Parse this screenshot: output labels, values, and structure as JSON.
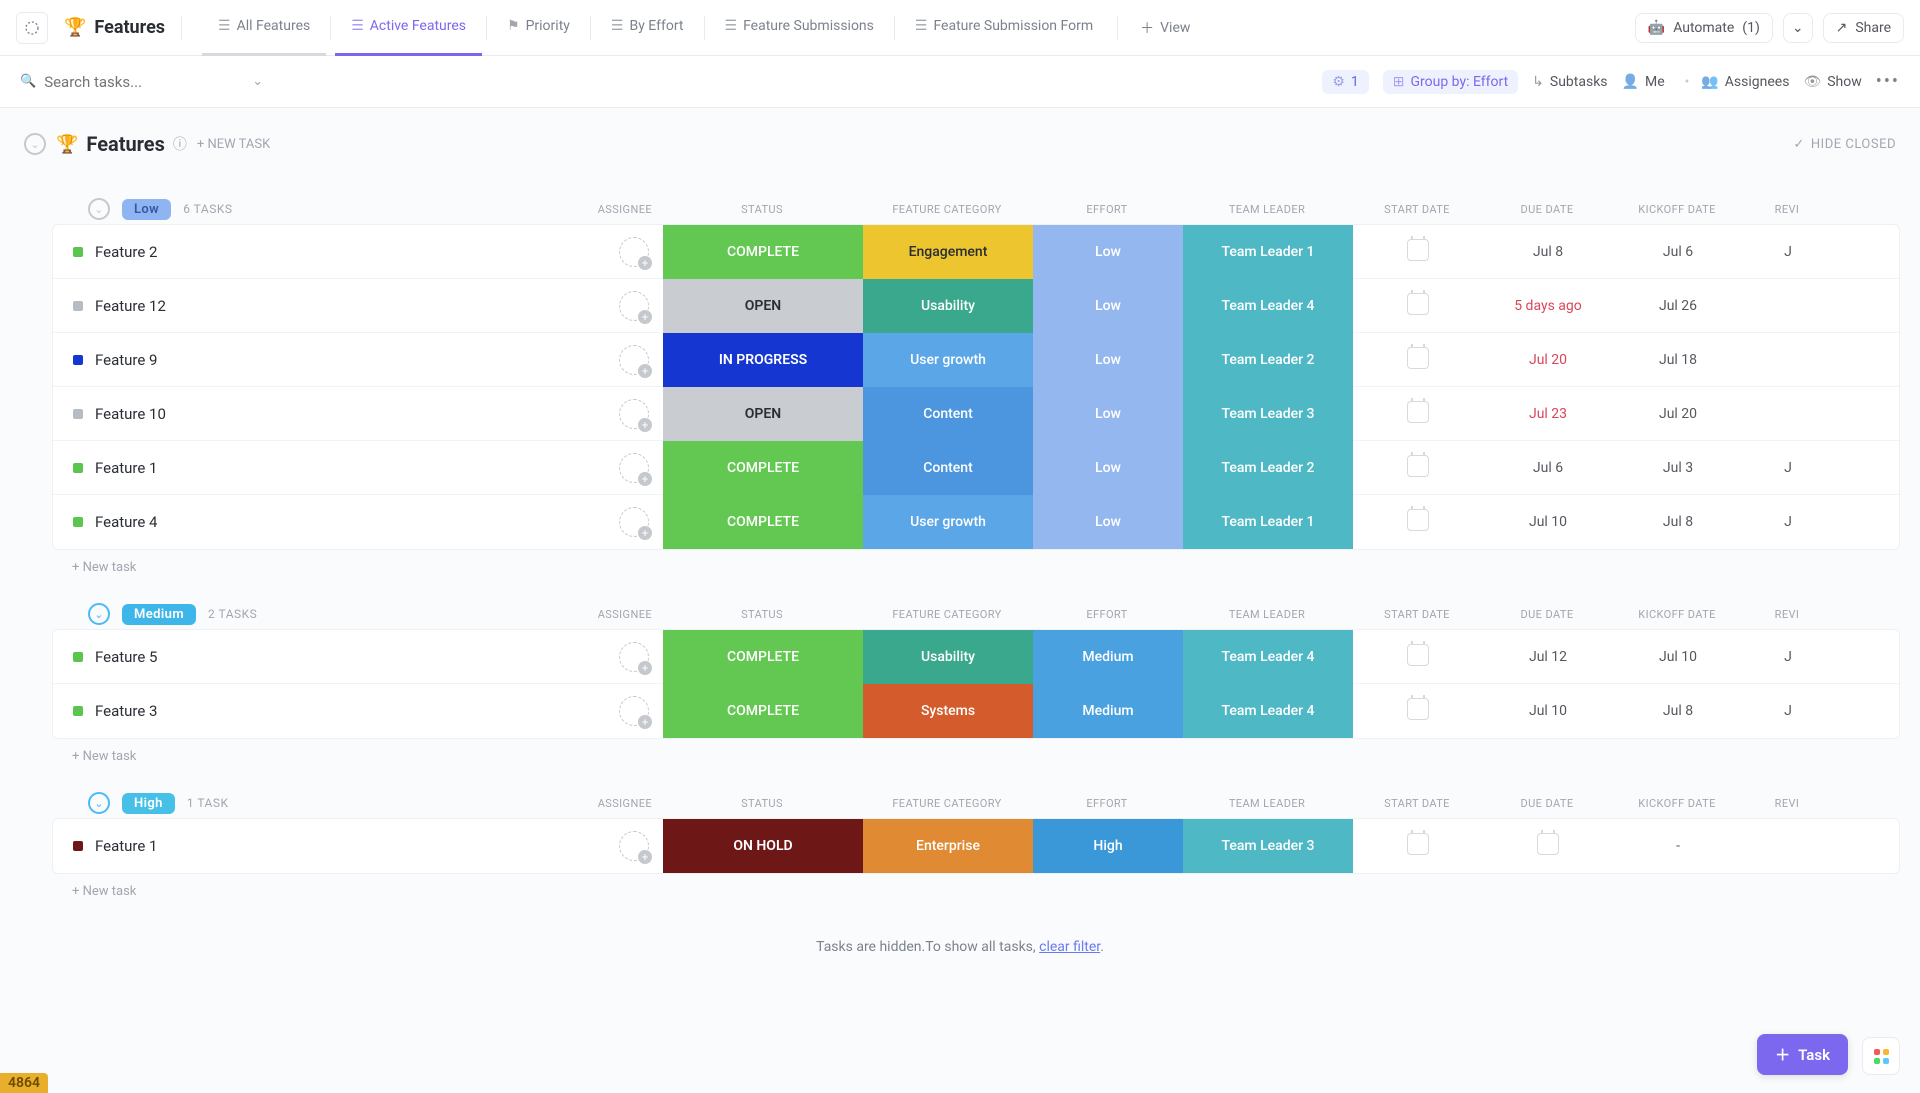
{
  "header": {
    "title": "Features",
    "tabs": [
      {
        "label": "All Features",
        "state": "underline"
      },
      {
        "label": "Active Features",
        "state": "primary"
      },
      {
        "label": "Priority",
        "state": ""
      },
      {
        "label": "By Effort",
        "state": ""
      },
      {
        "label": "Feature Submissions",
        "state": ""
      },
      {
        "label": "Feature Submission Form",
        "state": ""
      }
    ],
    "add_view": "View",
    "automate_label": "Automate",
    "automate_count": "(1)",
    "share_label": "Share"
  },
  "toolbar": {
    "search_placeholder": "Search tasks...",
    "filter_count": "1",
    "group_by_label": "Group by: Effort",
    "subtasks": "Subtasks",
    "me": "Me",
    "assignees": "Assignees",
    "show": "Show"
  },
  "list": {
    "title": "Features",
    "new_task": "+ NEW TASK",
    "hide_closed": "HIDE CLOSED"
  },
  "columns": {
    "assignee": "ASSIGNEE",
    "status": "STATUS",
    "category": "FEATURE CATEGORY",
    "effort": "EFFORT",
    "leader": "TEAM LEADER",
    "start": "START DATE",
    "due": "DUE DATE",
    "kickoff": "KICKOFF DATE",
    "review": "REVI"
  },
  "newTaskRow": "+ New task",
  "groups": [
    {
      "name": "Low",
      "badge_class": "badge-low",
      "collapse_class": "gray",
      "count": "6 TASKS",
      "tasks": [
        {
          "title": "Feature 2",
          "dot": "dot-green",
          "status": "COMPLETE",
          "status_cls": "st-complete",
          "cat": "Engagement",
          "cat_cls": "cat-engagement",
          "effort": "Low",
          "eff_cls": "eff-low",
          "leader": "Team Leader 1",
          "lead_cls": "lead-1",
          "start": "",
          "due": "Jul 8",
          "due_red": false,
          "kickoff": "Jul 6",
          "review": "J"
        },
        {
          "title": "Feature 12",
          "dot": "dot-gray",
          "status": "OPEN",
          "status_cls": "st-open",
          "cat": "Usability",
          "cat_cls": "cat-usability",
          "effort": "Low",
          "eff_cls": "eff-low",
          "leader": "Team Leader 4",
          "lead_cls": "lead-4",
          "start": "",
          "due": "5 days ago",
          "due_red": true,
          "kickoff": "Jul 26",
          "review": ""
        },
        {
          "title": "Feature 9",
          "dot": "dot-blue",
          "status": "IN PROGRESS",
          "status_cls": "st-progress",
          "cat": "User growth",
          "cat_cls": "cat-usergrowth",
          "effort": "Low",
          "eff_cls": "eff-low",
          "leader": "Team Leader 2",
          "lead_cls": "lead-2",
          "start": "",
          "due": "Jul 20",
          "due_red": true,
          "kickoff": "Jul 18",
          "review": ""
        },
        {
          "title": "Feature 10",
          "dot": "dot-gray",
          "status": "OPEN",
          "status_cls": "st-open",
          "cat": "Content",
          "cat_cls": "cat-content",
          "effort": "Low",
          "eff_cls": "eff-low",
          "leader": "Team Leader 3",
          "lead_cls": "lead-3",
          "start": "",
          "due": "Jul 23",
          "due_red": true,
          "kickoff": "Jul 20",
          "review": ""
        },
        {
          "title": "Feature 1",
          "dot": "dot-green",
          "status": "COMPLETE",
          "status_cls": "st-complete",
          "cat": "Content",
          "cat_cls": "cat-content",
          "effort": "Low",
          "eff_cls": "eff-low",
          "leader": "Team Leader 2",
          "lead_cls": "lead-2",
          "start": "",
          "due": "Jul 6",
          "due_red": false,
          "kickoff": "Jul 3",
          "review": "J"
        },
        {
          "title": "Feature 4",
          "dot": "dot-green",
          "status": "COMPLETE",
          "status_cls": "st-complete",
          "cat": "User growth",
          "cat_cls": "cat-usergrowth",
          "effort": "Low",
          "eff_cls": "eff-low",
          "leader": "Team Leader 1",
          "lead_cls": "lead-1",
          "start": "",
          "due": "Jul 10",
          "due_red": false,
          "kickoff": "Jul 8",
          "review": "J"
        }
      ]
    },
    {
      "name": "Medium",
      "badge_class": "badge-med",
      "collapse_class": "",
      "count": "2 TASKS",
      "tasks": [
        {
          "title": "Feature 5",
          "dot": "dot-green",
          "status": "COMPLETE",
          "status_cls": "st-complete",
          "cat": "Usability",
          "cat_cls": "cat-usability",
          "effort": "Medium",
          "eff_cls": "eff-med",
          "leader": "Team Leader 4",
          "lead_cls": "lead-4",
          "start": "",
          "due": "Jul 12",
          "due_red": false,
          "kickoff": "Jul 10",
          "review": "J"
        },
        {
          "title": "Feature 3",
          "dot": "dot-green",
          "status": "COMPLETE",
          "status_cls": "st-complete",
          "cat": "Systems",
          "cat_cls": "cat-systems",
          "effort": "Medium",
          "eff_cls": "eff-med",
          "leader": "Team Leader 4",
          "lead_cls": "lead-4",
          "start": "",
          "due": "Jul 10",
          "due_red": false,
          "kickoff": "Jul 8",
          "review": "J"
        }
      ]
    },
    {
      "name": "High",
      "badge_class": "badge-high",
      "collapse_class": "",
      "count": "1 TASK",
      "tasks": [
        {
          "title": "Feature 1",
          "dot": "dot-darkred",
          "status": "ON HOLD",
          "status_cls": "st-hold",
          "cat": "Enterprise",
          "cat_cls": "cat-enterprise",
          "effort": "High",
          "eff_cls": "eff-high",
          "leader": "Team Leader 3",
          "lead_cls": "lead-3",
          "start": "",
          "due": "",
          "due_red": false,
          "kickoff": "-",
          "review": ""
        }
      ]
    }
  ],
  "hidden_note": {
    "text_a": "Tasks are hidden.To show all tasks, ",
    "link": "clear filter",
    "text_b": "."
  },
  "bottom_badge": "4864",
  "fab": "Task"
}
